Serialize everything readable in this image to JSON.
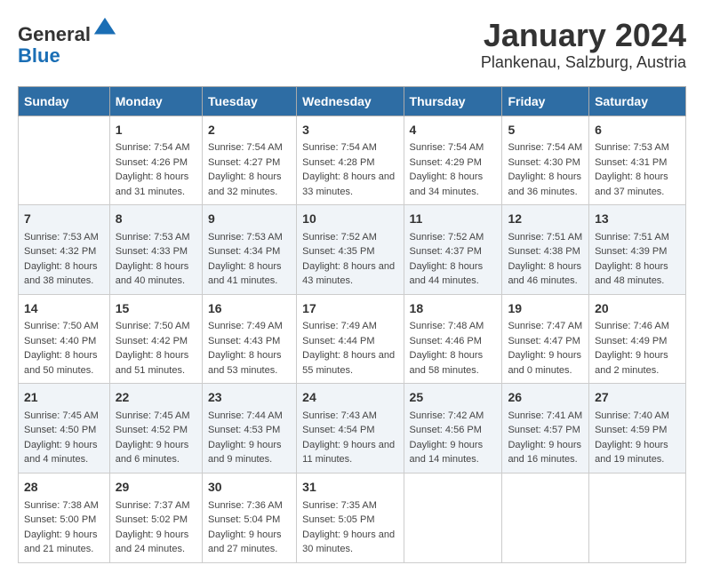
{
  "header": {
    "logo_general": "General",
    "logo_blue": "Blue",
    "title": "January 2024",
    "subtitle": "Plankenau, Salzburg, Austria"
  },
  "calendar": {
    "days": [
      "Sunday",
      "Monday",
      "Tuesday",
      "Wednesday",
      "Thursday",
      "Friday",
      "Saturday"
    ],
    "weeks": [
      [
        {
          "day": "",
          "sunrise": "",
          "sunset": "",
          "daylight": ""
        },
        {
          "day": "1",
          "sunrise": "Sunrise: 7:54 AM",
          "sunset": "Sunset: 4:26 PM",
          "daylight": "Daylight: 8 hours and 31 minutes."
        },
        {
          "day": "2",
          "sunrise": "Sunrise: 7:54 AM",
          "sunset": "Sunset: 4:27 PM",
          "daylight": "Daylight: 8 hours and 32 minutes."
        },
        {
          "day": "3",
          "sunrise": "Sunrise: 7:54 AM",
          "sunset": "Sunset: 4:28 PM",
          "daylight": "Daylight: 8 hours and 33 minutes."
        },
        {
          "day": "4",
          "sunrise": "Sunrise: 7:54 AM",
          "sunset": "Sunset: 4:29 PM",
          "daylight": "Daylight: 8 hours and 34 minutes."
        },
        {
          "day": "5",
          "sunrise": "Sunrise: 7:54 AM",
          "sunset": "Sunset: 4:30 PM",
          "daylight": "Daylight: 8 hours and 36 minutes."
        },
        {
          "day": "6",
          "sunrise": "Sunrise: 7:53 AM",
          "sunset": "Sunset: 4:31 PM",
          "daylight": "Daylight: 8 hours and 37 minutes."
        }
      ],
      [
        {
          "day": "7",
          "sunrise": "Sunrise: 7:53 AM",
          "sunset": "Sunset: 4:32 PM",
          "daylight": "Daylight: 8 hours and 38 minutes."
        },
        {
          "day": "8",
          "sunrise": "Sunrise: 7:53 AM",
          "sunset": "Sunset: 4:33 PM",
          "daylight": "Daylight: 8 hours and 40 minutes."
        },
        {
          "day": "9",
          "sunrise": "Sunrise: 7:53 AM",
          "sunset": "Sunset: 4:34 PM",
          "daylight": "Daylight: 8 hours and 41 minutes."
        },
        {
          "day": "10",
          "sunrise": "Sunrise: 7:52 AM",
          "sunset": "Sunset: 4:35 PM",
          "daylight": "Daylight: 8 hours and 43 minutes."
        },
        {
          "day": "11",
          "sunrise": "Sunrise: 7:52 AM",
          "sunset": "Sunset: 4:37 PM",
          "daylight": "Daylight: 8 hours and 44 minutes."
        },
        {
          "day": "12",
          "sunrise": "Sunrise: 7:51 AM",
          "sunset": "Sunset: 4:38 PM",
          "daylight": "Daylight: 8 hours and 46 minutes."
        },
        {
          "day": "13",
          "sunrise": "Sunrise: 7:51 AM",
          "sunset": "Sunset: 4:39 PM",
          "daylight": "Daylight: 8 hours and 48 minutes."
        }
      ],
      [
        {
          "day": "14",
          "sunrise": "Sunrise: 7:50 AM",
          "sunset": "Sunset: 4:40 PM",
          "daylight": "Daylight: 8 hours and 50 minutes."
        },
        {
          "day": "15",
          "sunrise": "Sunrise: 7:50 AM",
          "sunset": "Sunset: 4:42 PM",
          "daylight": "Daylight: 8 hours and 51 minutes."
        },
        {
          "day": "16",
          "sunrise": "Sunrise: 7:49 AM",
          "sunset": "Sunset: 4:43 PM",
          "daylight": "Daylight: 8 hours and 53 minutes."
        },
        {
          "day": "17",
          "sunrise": "Sunrise: 7:49 AM",
          "sunset": "Sunset: 4:44 PM",
          "daylight": "Daylight: 8 hours and 55 minutes."
        },
        {
          "day": "18",
          "sunrise": "Sunrise: 7:48 AM",
          "sunset": "Sunset: 4:46 PM",
          "daylight": "Daylight: 8 hours and 58 minutes."
        },
        {
          "day": "19",
          "sunrise": "Sunrise: 7:47 AM",
          "sunset": "Sunset: 4:47 PM",
          "daylight": "Daylight: 9 hours and 0 minutes."
        },
        {
          "day": "20",
          "sunrise": "Sunrise: 7:46 AM",
          "sunset": "Sunset: 4:49 PM",
          "daylight": "Daylight: 9 hours and 2 minutes."
        }
      ],
      [
        {
          "day": "21",
          "sunrise": "Sunrise: 7:45 AM",
          "sunset": "Sunset: 4:50 PM",
          "daylight": "Daylight: 9 hours and 4 minutes."
        },
        {
          "day": "22",
          "sunrise": "Sunrise: 7:45 AM",
          "sunset": "Sunset: 4:52 PM",
          "daylight": "Daylight: 9 hours and 6 minutes."
        },
        {
          "day": "23",
          "sunrise": "Sunrise: 7:44 AM",
          "sunset": "Sunset: 4:53 PM",
          "daylight": "Daylight: 9 hours and 9 minutes."
        },
        {
          "day": "24",
          "sunrise": "Sunrise: 7:43 AM",
          "sunset": "Sunset: 4:54 PM",
          "daylight": "Daylight: 9 hours and 11 minutes."
        },
        {
          "day": "25",
          "sunrise": "Sunrise: 7:42 AM",
          "sunset": "Sunset: 4:56 PM",
          "daylight": "Daylight: 9 hours and 14 minutes."
        },
        {
          "day": "26",
          "sunrise": "Sunrise: 7:41 AM",
          "sunset": "Sunset: 4:57 PM",
          "daylight": "Daylight: 9 hours and 16 minutes."
        },
        {
          "day": "27",
          "sunrise": "Sunrise: 7:40 AM",
          "sunset": "Sunset: 4:59 PM",
          "daylight": "Daylight: 9 hours and 19 minutes."
        }
      ],
      [
        {
          "day": "28",
          "sunrise": "Sunrise: 7:38 AM",
          "sunset": "Sunset: 5:00 PM",
          "daylight": "Daylight: 9 hours and 21 minutes."
        },
        {
          "day": "29",
          "sunrise": "Sunrise: 7:37 AM",
          "sunset": "Sunset: 5:02 PM",
          "daylight": "Daylight: 9 hours and 24 minutes."
        },
        {
          "day": "30",
          "sunrise": "Sunrise: 7:36 AM",
          "sunset": "Sunset: 5:04 PM",
          "daylight": "Daylight: 9 hours and 27 minutes."
        },
        {
          "day": "31",
          "sunrise": "Sunrise: 7:35 AM",
          "sunset": "Sunset: 5:05 PM",
          "daylight": "Daylight: 9 hours and 30 minutes."
        },
        {
          "day": "",
          "sunrise": "",
          "sunset": "",
          "daylight": ""
        },
        {
          "day": "",
          "sunrise": "",
          "sunset": "",
          "daylight": ""
        },
        {
          "day": "",
          "sunrise": "",
          "sunset": "",
          "daylight": ""
        }
      ]
    ]
  }
}
